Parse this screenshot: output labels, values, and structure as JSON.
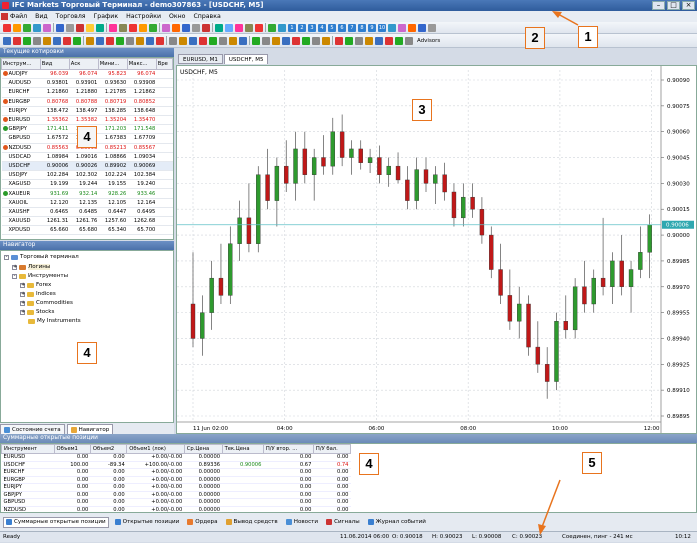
{
  "window": {
    "title": "IFC Markets Торговый Терминал - demo307863 - [USDCHF, M5]"
  },
  "menu": [
    "Файл",
    "Вид",
    "Торговля",
    "График",
    "Настройки",
    "Окно",
    "Справка"
  ],
  "toolbar": {
    "advisors": "Advisors",
    "periods": [
      "1",
      "2",
      "3",
      "4",
      "5",
      "6",
      "7",
      "8",
      "9",
      "10"
    ]
  },
  "quotes": {
    "title": "Текущие котировки",
    "headers": [
      "Инструм...",
      "Вид",
      "Аск",
      "Мини...",
      "Макс...",
      "Вре"
    ],
    "rows": [
      {
        "sym": "AUDJPY",
        "bid": "96.039",
        "ask": "96.074",
        "min": "95.823",
        "max": "96.074",
        "color": "dn"
      },
      {
        "sym": "AUDUSD",
        "bid": "0.93801",
        "ask": "0.93901",
        "min": "0.93630",
        "max": "0.93908",
        "color": "nt"
      },
      {
        "sym": "EURCHF",
        "bid": "1.21860",
        "ask": "1.21880",
        "min": "1.21785",
        "max": "1.21862",
        "color": "nt"
      },
      {
        "sym": "EURGBP",
        "bid": "0.80768",
        "ask": "0.80788",
        "min": "0.80719",
        "max": "0.80852",
        "color": "dn"
      },
      {
        "sym": "EURJPY",
        "bid": "138.472",
        "ask": "138.497",
        "min": "138.285",
        "max": "138.648",
        "color": "nt"
      },
      {
        "sym": "EURUSD",
        "bid": "1.35362",
        "ask": "1.35382",
        "min": "1.35204",
        "max": "1.35470",
        "color": "dn"
      },
      {
        "sym": "GBPJPY",
        "bid": "171.411",
        "ask": "171.436",
        "min": "171.203",
        "max": "171.548",
        "color": "up"
      },
      {
        "sym": "GBPUSD",
        "bid": "1.67572",
        "ask": "1.67592",
        "min": "1.67383",
        "max": "1.67709",
        "color": "nt"
      },
      {
        "sym": "NZDUSD",
        "bid": "0.85563",
        "ask": "0.85593",
        "min": "0.85213",
        "max": "0.85567",
        "color": "dn"
      },
      {
        "sym": "USDCAD",
        "bid": "1.08984",
        "ask": "1.09016",
        "min": "1.08866",
        "max": "1.09034",
        "color": "nt"
      },
      {
        "sym": "USDCHF",
        "bid": "0.90006",
        "ask": "0.90026",
        "min": "0.89902",
        "max": "0.90069",
        "color": "nt"
      },
      {
        "sym": "USDJPY",
        "bid": "102.284",
        "ask": "102.302",
        "min": "102.224",
        "max": "102.384",
        "color": "nt"
      },
      {
        "sym": "XAGUSD",
        "bid": "19.199",
        "ask": "19.244",
        "min": "19.155",
        "max": "19.240",
        "color": "nt"
      },
      {
        "sym": "XAUEUR",
        "bid": "931.69",
        "ask": "932.14",
        "min": "928.26",
        "max": "933.46",
        "color": "up"
      },
      {
        "sym": "XAUOIL",
        "bid": "12.120",
        "ask": "12.135",
        "min": "12.105",
        "max": "12.164",
        "color": "nt"
      },
      {
        "sym": "XAUSHF",
        "bid": "0.6465",
        "ask": "0.6485",
        "min": "0.6447",
        "max": "0.6495",
        "color": "nt"
      },
      {
        "sym": "XAUUSD",
        "bid": "1261.31",
        "ask": "1261.76",
        "min": "1257.60",
        "max": "1262.68",
        "color": "nt"
      },
      {
        "sym": "XPDUSD",
        "bid": "65.660",
        "ask": "65.680",
        "min": "65.340",
        "max": "65.700",
        "color": "nt"
      }
    ]
  },
  "navigator": {
    "title": "Навигатор",
    "root": "Торговый терминал",
    "logins": "Логины",
    "instruments": "Инструменты",
    "folders": [
      "Forex",
      "Indices",
      "Commodities",
      "Stocks",
      "My Instruments"
    ]
  },
  "left_tabs": [
    "Состояние счета",
    "Навигатор"
  ],
  "chart": {
    "tabs": [
      "EURUSD, M1",
      "USDCHF, M5"
    ],
    "label": "USDCHF, M5",
    "current_price": "0.90006"
  },
  "chart_data": {
    "type": "candlestick",
    "symbol": "USDCHF",
    "timeframe": "M5",
    "ylim": [
      0.89895,
      0.9009
    ],
    "y_ticks": [
      "0.90090",
      "0.90075",
      "0.90060",
      "0.90045",
      "0.90030",
      "0.90015",
      "0.90000",
      "0.89985",
      "0.89970",
      "0.89955",
      "0.89940",
      "0.89925",
      "0.89910",
      "0.89895"
    ],
    "x_ticks": [
      "11 Jun 02:00",
      "04:00",
      "06:00",
      "08:00",
      "10:00",
      "12:00"
    ],
    "candles": [
      [
        0.8996,
        0.8999,
        0.89935,
        0.8994
      ],
      [
        0.8994,
        0.89965,
        0.8993,
        0.89955
      ],
      [
        0.89955,
        0.89985,
        0.89945,
        0.89975
      ],
      [
        0.89975,
        0.89995,
        0.8996,
        0.89965
      ],
      [
        0.89965,
        0.90005,
        0.8996,
        0.89995
      ],
      [
        0.89995,
        0.9002,
        0.89985,
        0.9001
      ],
      [
        0.9001,
        0.9003,
        0.8999,
        0.89995
      ],
      [
        0.89995,
        0.9004,
        0.8999,
        0.90035
      ],
      [
        0.90035,
        0.9005,
        0.90015,
        0.9002
      ],
      [
        0.9002,
        0.90045,
        0.90005,
        0.9004
      ],
      [
        0.9004,
        0.90055,
        0.90025,
        0.9003
      ],
      [
        0.9003,
        0.9006,
        0.9002,
        0.9005
      ],
      [
        0.9005,
        0.9006,
        0.9003,
        0.90035
      ],
      [
        0.90035,
        0.9005,
        0.9002,
        0.90045
      ],
      [
        0.90045,
        0.90058,
        0.90035,
        0.9004
      ],
      [
        0.9004,
        0.90068,
        0.90035,
        0.9006
      ],
      [
        0.9006,
        0.9007,
        0.9004,
        0.90045
      ],
      [
        0.90045,
        0.90055,
        0.90035,
        0.9005
      ],
      [
        0.9005,
        0.90055,
        0.90038,
        0.90042
      ],
      [
        0.90042,
        0.9005,
        0.90036,
        0.90045
      ],
      [
        0.90045,
        0.90052,
        0.9003,
        0.90035
      ],
      [
        0.90035,
        0.90045,
        0.90028,
        0.9004
      ],
      [
        0.9004,
        0.90048,
        0.9003,
        0.90032
      ],
      [
        0.90032,
        0.9004,
        0.90015,
        0.9002
      ],
      [
        0.9002,
        0.90045,
        0.90015,
        0.90038
      ],
      [
        0.90038,
        0.90045,
        0.90025,
        0.9003
      ],
      [
        0.9003,
        0.9004,
        0.90018,
        0.90035
      ],
      [
        0.90035,
        0.90042,
        0.9002,
        0.90025
      ],
      [
        0.90025,
        0.9003,
        0.90005,
        0.9001
      ],
      [
        0.9001,
        0.9003,
        0.90005,
        0.90022
      ],
      [
        0.90022,
        0.9003,
        0.9001,
        0.90015
      ],
      [
        0.90015,
        0.90022,
        0.89995,
        0.9
      ],
      [
        0.9,
        0.90005,
        0.89975,
        0.8998
      ],
      [
        0.8998,
        0.89995,
        0.8996,
        0.89965
      ],
      [
        0.89965,
        0.8998,
        0.89945,
        0.8995
      ],
      [
        0.8995,
        0.8997,
        0.8994,
        0.8996
      ],
      [
        0.8996,
        0.89965,
        0.8993,
        0.89935
      ],
      [
        0.89935,
        0.8995,
        0.8992,
        0.89925
      ],
      [
        0.89925,
        0.89935,
        0.89905,
        0.89915
      ],
      [
        0.89915,
        0.89955,
        0.8991,
        0.8995
      ],
      [
        0.8995,
        0.89965,
        0.8994,
        0.89945
      ],
      [
        0.89945,
        0.89975,
        0.8994,
        0.8997
      ],
      [
        0.8997,
        0.89985,
        0.89955,
        0.8996
      ],
      [
        0.8996,
        0.8998,
        0.89955,
        0.89975
      ],
      [
        0.89975,
        0.9001,
        0.89965,
        0.8997
      ],
      [
        0.8997,
        0.8999,
        0.8996,
        0.89985
      ],
      [
        0.89985,
        0.9,
        0.89965,
        0.8997
      ],
      [
        0.8997,
        0.89985,
        0.89955,
        0.8998
      ],
      [
        0.8998,
        0.90005,
        0.89975,
        0.8999
      ],
      [
        0.8999,
        0.90012,
        0.89975,
        0.90006
      ]
    ]
  },
  "positions": {
    "title": "Суммарные открытые позиции",
    "headers": [
      "Инструмент",
      "Объем1",
      "Объем2",
      "Объем1 (лок)",
      "Ср.Цена",
      "Тек.Цена",
      "П/У втор. ...",
      "П/У бал."
    ],
    "rows": [
      [
        "EURUSD",
        "0.00",
        "0.00",
        "+0.00/-0.00",
        "0.00000",
        "",
        "0.00",
        "0.00"
      ],
      [
        "USDCHF",
        "100.00",
        "-89.34",
        "+100.00/-0.00",
        "0.89336",
        "0.90006",
        "0.67",
        "0.74"
      ],
      [
        "EURCHF",
        "0.00",
        "0.00",
        "+0.00/-0.00",
        "0.00000",
        "",
        "0.00",
        "0.00"
      ],
      [
        "EURGBP",
        "0.00",
        "0.00",
        "+0.00/-0.00",
        "0.00000",
        "",
        "0.00",
        "0.00"
      ],
      [
        "EURJPY",
        "0.00",
        "0.00",
        "+0.00/-0.00",
        "0.00000",
        "",
        "0.00",
        "0.00"
      ],
      [
        "GBPJPY",
        "0.00",
        "0.00",
        "+0.00/-0.00",
        "0.00000",
        "",
        "0.00",
        "0.00"
      ],
      [
        "GBPUSD",
        "0.00",
        "0.00",
        "+0.00/-0.00",
        "0.00000",
        "",
        "0.00",
        "0.00"
      ],
      [
        "NZDUSD",
        "0.00",
        "0.00",
        "+0.00/-0.00",
        "0.00000",
        "",
        "0.00",
        "0.00"
      ]
    ]
  },
  "bottom_tabs": [
    "Суммарные открытые позиции",
    "Открытые позиции",
    "Ордера",
    "Вывод средств",
    "Новости",
    "Сигналы",
    "Журнал событий"
  ],
  "status": {
    "left": "Ready",
    "datetime": "11.06.2014 06:00",
    "open": "O: 0.90018",
    "high": "H: 0.90023",
    "low": "L: 0.90008",
    "close": "C: 0.90023",
    "connection": "Соединен, пинг - 241 мс",
    "clock": "10:12"
  },
  "callouts": [
    "1",
    "2",
    "3",
    "4",
    "4",
    "4",
    "5"
  ],
  "colors": {
    "bull": "#2e9a2e",
    "bear": "#c01818",
    "callout": "#e8741e"
  }
}
